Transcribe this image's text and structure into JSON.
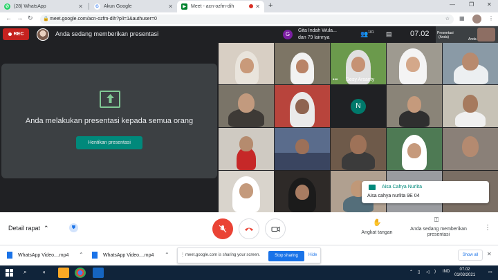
{
  "browser": {
    "tabs": [
      {
        "title": "(28) WhatsApp"
      },
      {
        "title": "Akun Google"
      },
      {
        "title": "Meet - acn-ozfm-dih"
      }
    ],
    "url": "meet.google.com/acn-ozfm-dih?pli=1&authuser=0"
  },
  "meet_header": {
    "rec_label": "REC",
    "presenting_text": "Anda sedang memberikan presentasi",
    "participants_avatar_letter": "G",
    "participants_line1": "Gita Indah Wula...",
    "participants_line2": "dan 79 lainnya",
    "participant_count": "101",
    "time": "07.02",
    "presenter_tile_line1": "Presentasi",
    "presenter_tile_line2": "(Anda)",
    "presenter_tile_name": "Anda"
  },
  "presentation": {
    "message": "Anda melakukan presentasi kepada semua orang",
    "stop_button": "Hentikan presentasi"
  },
  "grid": {
    "tile_names": [
      "Desy Arsanty"
    ],
    "avatar_letter": "N"
  },
  "chat_popup": {
    "name": "Aisa Cahya Nurlita",
    "message": "Aisa cahya nurlita 9E 04"
  },
  "bottom": {
    "meeting_details": "Detail rapat",
    "raise_hand": "Angkat tangan",
    "present_now_line1": "Anda sedang memberikan",
    "present_now_line2": "presentasi"
  },
  "downloads": {
    "items": [
      "WhatsApp Video....mp4",
      "WhatsApp Video....mp4"
    ],
    "share_text": "meet.google.com is sharing your screen.",
    "stop_sharing": "Stop sharing",
    "hide": "Hide",
    "show_all": "Show all"
  },
  "taskbar": {
    "language": "IND",
    "time": "07.02",
    "date": "01/03/2021"
  },
  "colors": {
    "rec_red": "#c5221f",
    "meet_dark": "#202124",
    "teal": "#00897b",
    "end_call_red": "#ea4335",
    "link_blue": "#1a73e8"
  }
}
